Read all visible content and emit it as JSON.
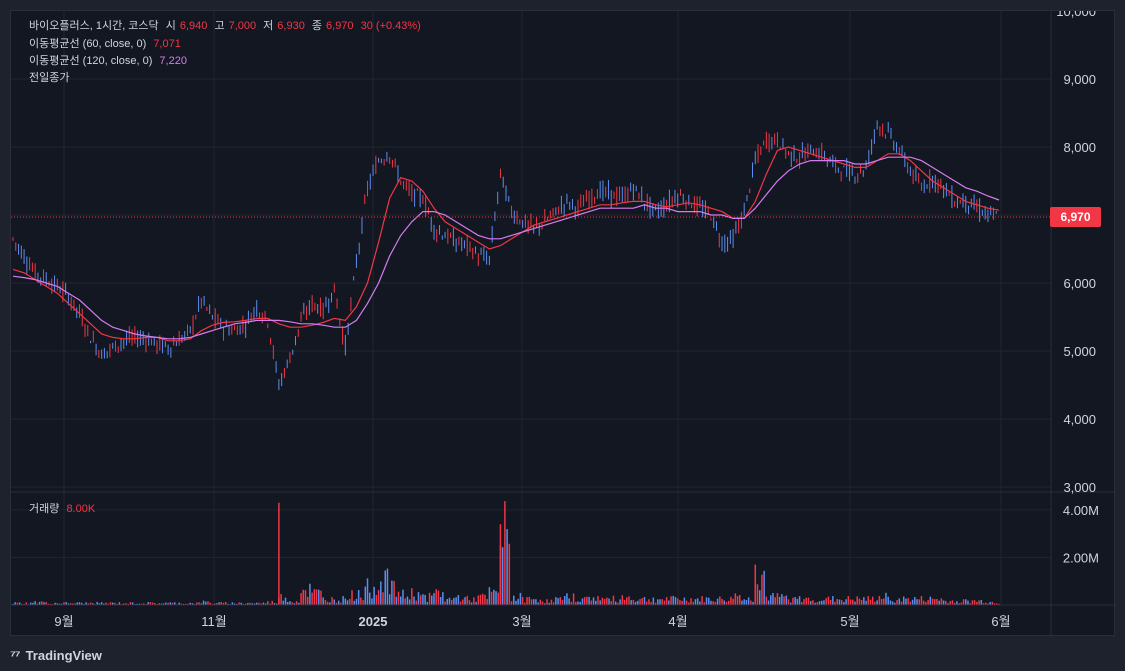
{
  "header": {
    "symbol": "바이오플러스, 1시간, 코스닥",
    "open_label": "시",
    "open_value": "6,940",
    "high_label": "고",
    "high_value": "7,000",
    "low_label": "저",
    "low_value": "6,930",
    "close_label": "종",
    "close_value": "6,970",
    "change": "30 (+0.43%)"
  },
  "indicators": {
    "ma60_label": "이동평균선 (60, close, 0)",
    "ma60_value": "7,071",
    "ma120_label": "이동평균선 (120, close, 0)",
    "ma120_value": "7,220",
    "prev_close_label": "전일종가"
  },
  "volume": {
    "label": "거래량",
    "value": "8.00K"
  },
  "price_badge": "6,970",
  "footer": {
    "brand": "TradingView"
  },
  "colors": {
    "up": "#f23645",
    "down": "#2962ff",
    "candle_blue": "#5b8def",
    "ma60": "#f23645",
    "ma120": "#d67cf0",
    "grid": "#1f2430",
    "text": "#d1d4dc"
  },
  "chart_data": {
    "type": "line",
    "price_axis_ticks": [
      "10,000",
      "9,000",
      "8,000",
      "7,000",
      "6,000",
      "5,000",
      "4,000",
      "3,000"
    ],
    "price_axis_values": [
      10000,
      9000,
      8000,
      7000,
      6000,
      5000,
      4000,
      3000
    ],
    "volume_axis_ticks": [
      "4.00M",
      "2.00M"
    ],
    "time_labels": [
      "9월",
      "11월",
      "2025",
      "3월",
      "4월",
      "5월",
      "6월"
    ],
    "ylim": [
      3000,
      10000
    ],
    "last_price": 6970,
    "price_series": {
      "name": "close",
      "values": [
        6650,
        6400,
        6150,
        6050,
        5950,
        5800,
        5550,
        5200,
        4950,
        5050,
        5150,
        5200,
        5180,
        5100,
        5050,
        5150,
        5300,
        5750,
        5500,
        5350,
        5300,
        5400,
        5650,
        5450,
        4500,
        4900,
        5450,
        5700,
        5600,
        5900,
        5050,
        6300,
        7400,
        7800,
        7900,
        7500,
        7300,
        7250,
        6800,
        6700,
        6600,
        6550,
        6400,
        6350,
        7600,
        7050,
        6900,
        6800,
        6900,
        7050,
        7200,
        7100,
        7250,
        7350,
        7300,
        7250,
        7400,
        7200,
        7050,
        7150,
        7300,
        7200,
        7100,
        7000,
        6600,
        6650,
        7050,
        7800,
        8100,
        8100,
        7900,
        7850,
        7950,
        7900,
        7750,
        7650,
        7600,
        7700,
        8350,
        8200,
        7950,
        7650,
        7400,
        7550,
        7400,
        7200,
        7200,
        7100,
        7000,
        6970
      ],
      "approximate": true
    },
    "series": [
      {
        "name": "이동평균선 (60, close, 0)",
        "color": "#f23645",
        "values": [
          6200,
          6150,
          6050,
          5950,
          5850,
          5700,
          5550,
          5400,
          5250,
          5200,
          5180,
          5180,
          5200,
          5200,
          5150,
          5150,
          5180,
          5300,
          5380,
          5420,
          5430,
          5450,
          5480,
          5480,
          5400,
          5350,
          5350,
          5380,
          5420,
          5480,
          5450,
          5650,
          6000,
          6600,
          7250,
          7550,
          7500,
          7350,
          7100,
          6900,
          6800,
          6700,
          6600,
          6500,
          6550,
          6650,
          6750,
          6850,
          6900,
          6950,
          7000,
          7050,
          7100,
          7150,
          7150,
          7180,
          7200,
          7200,
          7150,
          7120,
          7150,
          7180,
          7150,
          7100,
          7050,
          6950,
          6950,
          7200,
          7600,
          7950,
          8000,
          7950,
          7900,
          7850,
          7800,
          7750,
          7700,
          7700,
          7800,
          7900,
          7900,
          7800,
          7650,
          7500,
          7400,
          7300,
          7200,
          7150,
          7100,
          7071
        ]
      },
      {
        "name": "이동평균선 (120, close, 0)",
        "color": "#d67cf0",
        "values": [
          6100,
          6080,
          6050,
          6000,
          5950,
          5850,
          5750,
          5600,
          5450,
          5350,
          5300,
          5250,
          5220,
          5200,
          5180,
          5180,
          5200,
          5250,
          5300,
          5350,
          5400,
          5420,
          5450,
          5450,
          5450,
          5430,
          5400,
          5400,
          5380,
          5350,
          5350,
          5450,
          5700,
          6000,
          6400,
          6700,
          6900,
          7050,
          7050,
          7000,
          6900,
          6800,
          6700,
          6650,
          6650,
          6700,
          6750,
          6800,
          6850,
          6900,
          6950,
          7000,
          7050,
          7100,
          7100,
          7100,
          7100,
          7150,
          7100,
          7100,
          7050,
          7050,
          7050,
          7000,
          7000,
          6950,
          6950,
          7100,
          7300,
          7500,
          7650,
          7750,
          7800,
          7800,
          7800,
          7800,
          7750,
          7750,
          7800,
          7850,
          7850,
          7850,
          7800,
          7700,
          7600,
          7500,
          7400,
          7350,
          7280,
          7220
        ]
      }
    ],
    "volume_series": {
      "name": "거래량",
      "values": [
        0.1,
        0.1,
        0.15,
        0.1,
        0.1,
        0.1,
        0.1,
        0.1,
        0.1,
        0.1,
        0.1,
        0.1,
        0.1,
        0.1,
        0.1,
        0.1,
        0.1,
        0.15,
        0.1,
        0.1,
        0.1,
        0.1,
        0.1,
        0.15,
        0.4,
        0.2,
        0.8,
        0.6,
        0.3,
        0.3,
        0.5,
        0.6,
        0.9,
        1.5,
        0.8,
        0.5,
        0.6,
        0.4,
        0.6,
        0.3,
        0.4,
        0.3,
        0.4,
        0.6,
        3.5,
        0.4,
        0.3,
        0.3,
        0.2,
        0.3,
        0.4,
        0.3,
        0.4,
        0.3,
        0.3,
        0.4,
        0.3,
        0.3,
        0.3,
        0.3,
        0.3,
        0.3,
        0.3,
        0.3,
        0.3,
        0.5,
        0.3,
        1.6,
        0.4,
        0.4,
        0.3,
        0.3,
        0.3,
        0.3,
        0.3,
        0.3,
        0.3,
        0.3,
        0.4,
        0.3,
        0.3,
        0.3,
        0.3,
        0.3,
        0.2,
        0.2,
        0.2,
        0.2,
        0.15,
        0.1
      ],
      "spikes": [
        {
          "at": 24,
          "value": 4.3
        },
        {
          "at": 44,
          "value": 3.4
        },
        {
          "at": 67,
          "value": 1.7
        }
      ],
      "ylim": [
        0,
        4.5
      ],
      "unit": "M"
    }
  }
}
